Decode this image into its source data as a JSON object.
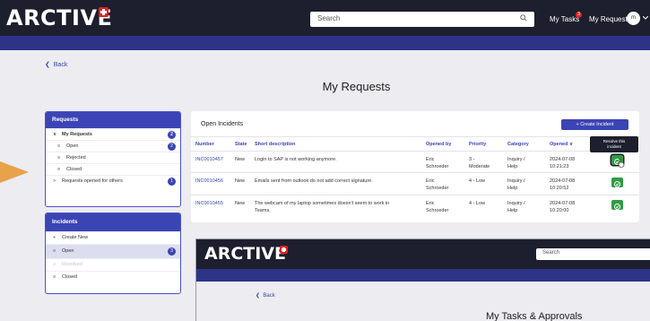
{
  "header": {
    "logo": "ARCTIVE",
    "search_placeholder": "Search",
    "my_tasks": "My Tasks",
    "my_tasks_badge": "3",
    "my_requests": "My Requests",
    "avatar_initials": "m"
  },
  "back_label": "Back",
  "page_title": "My Requests",
  "sidebar": {
    "requests": {
      "title": "Requests",
      "items": [
        {
          "label": "My Requests",
          "count": "2"
        },
        {
          "label": "Open",
          "count": "2"
        },
        {
          "label": "Rejected",
          "count": ""
        },
        {
          "label": "Closed",
          "count": ""
        },
        {
          "label": "Requests opened for others",
          "count": "1"
        }
      ]
    },
    "incidents": {
      "title": "Incidents",
      "items": [
        {
          "label": "Create New",
          "count": ""
        },
        {
          "label": "Open",
          "count": "3"
        },
        {
          "label": "Resolved",
          "count": ""
        },
        {
          "label": "Closed",
          "count": ""
        }
      ]
    }
  },
  "table": {
    "title": "Open Incidents",
    "create_button": "+ Create Incident",
    "columns": [
      "Number",
      "State",
      "Short description",
      "Opened by",
      "Priority",
      "Category",
      "Opened"
    ],
    "rows": [
      {
        "number": "INC0010457",
        "state": "New",
        "desc": [
          "Login to SAP is not working anymore.",
          ""
        ],
        "opened_by": [
          "Eric",
          "Schroeder"
        ],
        "priority": [
          "3 -",
          "Moderate"
        ],
        "category": [
          "Inquiry /",
          "Help"
        ],
        "opened": [
          "2024-07-08",
          "10:21:23"
        ]
      },
      {
        "number": "INC0010456",
        "state": "New",
        "desc": [
          "Emails sent from outlook do not add correct signature.",
          ""
        ],
        "opened_by": [
          "Eric",
          "Schroeder"
        ],
        "priority": [
          "4 - Low",
          ""
        ],
        "category": [
          "Inquiry /",
          "Help"
        ],
        "opened": [
          "2024-07-08",
          "10:20:52"
        ]
      },
      {
        "number": "INC0010455",
        "state": "New",
        "desc": [
          "The webcam of my laptop sometimes doesn't seem to work in",
          "Teams."
        ],
        "opened_by": [
          "Eric",
          "Schroeder"
        ],
        "priority": [
          "4 - Low",
          ""
        ],
        "category": [
          "Inquiry /",
          "Help"
        ],
        "opened": [
          "2024-07-08",
          "10:20:00"
        ]
      }
    ],
    "tooltip": [
      "Resolve this",
      "incident"
    ]
  },
  "overlay_window": {
    "logo": "ARCTIVE",
    "search_placeholder": "Search",
    "back_label": "Back",
    "title": "My Tasks & Approvals"
  },
  "colors": {
    "header_bg": "#1d1f2e",
    "accent": "#3b44b4",
    "resolve_green": "#2e9d43",
    "brand_red": "#e02424"
  }
}
